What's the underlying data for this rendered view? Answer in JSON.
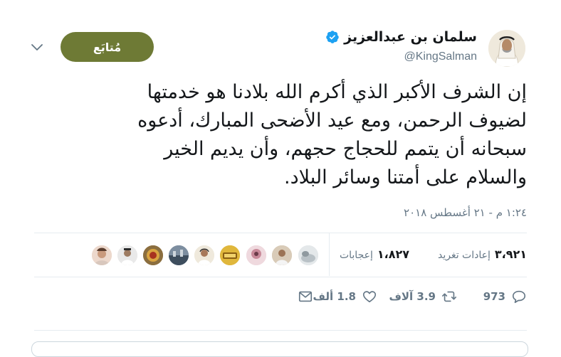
{
  "author": {
    "display_name": "سلمان بن عبدالعزيز",
    "handle": "@KingSalman",
    "verified": true
  },
  "follow_button_label": "مُتابَع",
  "tweet_lines": [
    "إن الشرف الأكبر الذي أكرم الله بلادنا هو خدمتها",
    "لضيوف الرحمن، ومع عيد الأضحى المبارك، أدعوه",
    "سبحانه أن يتمم للحجاج حجهم، وأن يديم الخير",
    "والسلام على أمتنا وسائر البلاد."
  ],
  "timestamp": "١:٢٤ م - ٢١ أغسطس ٢٠١٨",
  "stats": {
    "retweets_count": "٣،٩٢١",
    "retweets_label": "إعادات تغريد",
    "likes_count": "١،٨٢٧",
    "likes_label": "إعجابات"
  },
  "actions": {
    "reply_count": "973",
    "retweet_count": "3.9 آلاف",
    "like_count": "1.8 ألف"
  },
  "colors": {
    "follow_button": "#6e7a35",
    "verified": "#1da1f2",
    "secondary_text": "#657786"
  }
}
